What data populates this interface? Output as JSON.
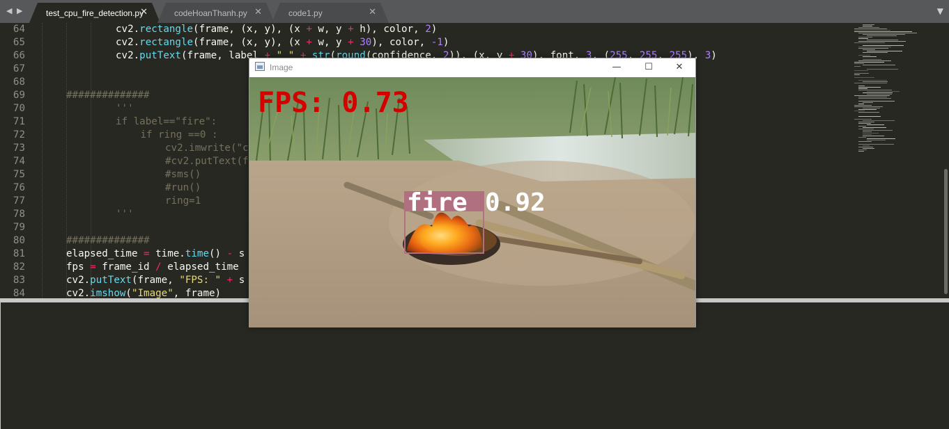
{
  "tabs": [
    {
      "label": "test_cpu_fire_detection.py",
      "active": true
    },
    {
      "label": "codeHoanThanh.py",
      "active": false
    },
    {
      "label": "code1.py",
      "active": false
    }
  ],
  "icons": {
    "back": "chevron-left-icon",
    "forward": "chevron-right-icon",
    "close": "close-icon",
    "dropdown": "chevron-down-icon"
  },
  "glyphs": {
    "back": "◀",
    "forward": "▶",
    "close": "✕",
    "dropdown": "▼",
    "minimize": "—",
    "maximize": "☐",
    "win_close": "✕"
  },
  "code_lines": [
    {
      "n": "64",
      "indent": 2,
      "tokens": [
        [
          "cv2.",
          ""
        ],
        [
          "rectangle",
          "fn"
        ],
        [
          "(frame, (x, y), (x ",
          ""
        ],
        [
          "+",
          "kw"
        ],
        [
          " w, y ",
          ""
        ],
        [
          "+",
          "kw"
        ],
        [
          " h), color, ",
          ""
        ],
        [
          "2",
          "num"
        ],
        [
          ")",
          ""
        ]
      ]
    },
    {
      "n": "65",
      "indent": 2,
      "tokens": [
        [
          "cv2.",
          ""
        ],
        [
          "rectangle",
          "fn"
        ],
        [
          "(frame, (x, y), (x ",
          ""
        ],
        [
          "+",
          "kw"
        ],
        [
          " w, y ",
          ""
        ],
        [
          "+",
          "kw"
        ],
        [
          " ",
          ""
        ],
        [
          "30",
          "num"
        ],
        [
          "), color, ",
          ""
        ],
        [
          "-1",
          "num"
        ],
        [
          ")",
          ""
        ]
      ]
    },
    {
      "n": "66",
      "indent": 2,
      "tokens": [
        [
          "cv2.",
          ""
        ],
        [
          "putText",
          "fn"
        ],
        [
          "(frame, label ",
          ""
        ],
        [
          "+",
          "kw"
        ],
        [
          " ",
          ""
        ],
        [
          "\" \"",
          "str"
        ],
        [
          " ",
          ""
        ],
        [
          "+",
          "kw"
        ],
        [
          " ",
          ""
        ],
        [
          "str",
          "fn"
        ],
        [
          "(",
          ""
        ],
        [
          "round",
          "fn"
        ],
        [
          "(confidence, ",
          ""
        ],
        [
          "2",
          "num"
        ],
        [
          ")), (x, y ",
          ""
        ],
        [
          "+",
          "kw"
        ],
        [
          " ",
          ""
        ],
        [
          "30",
          "num"
        ],
        [
          "), font, ",
          ""
        ],
        [
          "3",
          "num"
        ],
        [
          ", (",
          ""
        ],
        [
          "255",
          "num"
        ],
        [
          ", ",
          ""
        ],
        [
          "255",
          "num"
        ],
        [
          ", ",
          ""
        ],
        [
          "255",
          "num"
        ],
        [
          "), ",
          ""
        ],
        [
          "3",
          "num"
        ],
        [
          ")",
          ""
        ]
      ]
    },
    {
      "n": "67",
      "indent": 0,
      "tokens": []
    },
    {
      "n": "68",
      "indent": 0,
      "tokens": []
    },
    {
      "n": "69",
      "indent": 0,
      "tokens": [
        [
          "##############",
          "cm"
        ]
      ]
    },
    {
      "n": "70",
      "indent": 2,
      "tokens": [
        [
          "'''",
          "cm"
        ]
      ]
    },
    {
      "n": "71",
      "indent": 2,
      "tokens": [
        [
          "if label==\"fire\":",
          "cm"
        ]
      ]
    },
    {
      "n": "72",
      "indent": 3,
      "tokens": [
        [
          "if ring ==0 :",
          "cm"
        ]
      ]
    },
    {
      "n": "73",
      "indent": 4,
      "tokens": [
        [
          "cv2.imwrite(\"c",
          "cm"
        ]
      ]
    },
    {
      "n": "74",
      "indent": 4,
      "tokens": [
        [
          "#cv2.putText(f",
          "cm"
        ]
      ]
    },
    {
      "n": "75",
      "indent": 4,
      "tokens": [
        [
          "#sms()",
          "cm"
        ]
      ]
    },
    {
      "n": "76",
      "indent": 4,
      "tokens": [
        [
          "#run()",
          "cm"
        ]
      ]
    },
    {
      "n": "77",
      "indent": 4,
      "tokens": [
        [
          "ring=1",
          "cm"
        ]
      ]
    },
    {
      "n": "78",
      "indent": 2,
      "tokens": [
        [
          "'''",
          "cm"
        ]
      ]
    },
    {
      "n": "79",
      "indent": 0,
      "tokens": []
    },
    {
      "n": "80",
      "indent": 0,
      "tokens": [
        [
          "##############",
          "cm"
        ]
      ]
    },
    {
      "n": "81",
      "indent": 0,
      "tokens": [
        [
          "elapsed_time ",
          ""
        ],
        [
          "=",
          "kw"
        ],
        [
          " time.",
          ""
        ],
        [
          "time",
          "fn"
        ],
        [
          "() ",
          ""
        ],
        [
          "-",
          "kw"
        ],
        [
          " s",
          ""
        ]
      ]
    },
    {
      "n": "82",
      "indent": 0,
      "tokens": [
        [
          "fps ",
          ""
        ],
        [
          "=",
          "kw"
        ],
        [
          " frame_id ",
          ""
        ],
        [
          "/",
          "kw"
        ],
        [
          " elapsed_time",
          ""
        ]
      ]
    },
    {
      "n": "83",
      "indent": 0,
      "tokens": [
        [
          "cv2.",
          ""
        ],
        [
          "putText",
          "fn"
        ],
        [
          "(frame, ",
          ""
        ],
        [
          "\"FPS: \"",
          "str"
        ],
        [
          " ",
          ""
        ],
        [
          "+",
          "kw"
        ],
        [
          " s",
          ""
        ]
      ]
    },
    {
      "n": "84",
      "indent": 0,
      "tokens": [
        [
          "cv2.",
          ""
        ],
        [
          "imshow",
          "fn"
        ],
        [
          "(",
          ""
        ],
        [
          "\"Image\"",
          "str"
        ],
        [
          ", frame)",
          ""
        ]
      ]
    }
  ],
  "image_window": {
    "title": "Image",
    "fps_text": "FPS: 0.73",
    "detection_label": "fire",
    "detection_score": "0.92"
  },
  "colors": {
    "editor_bg": "#272822",
    "fps_text": "#d40000",
    "detection_box": "#b07080"
  }
}
